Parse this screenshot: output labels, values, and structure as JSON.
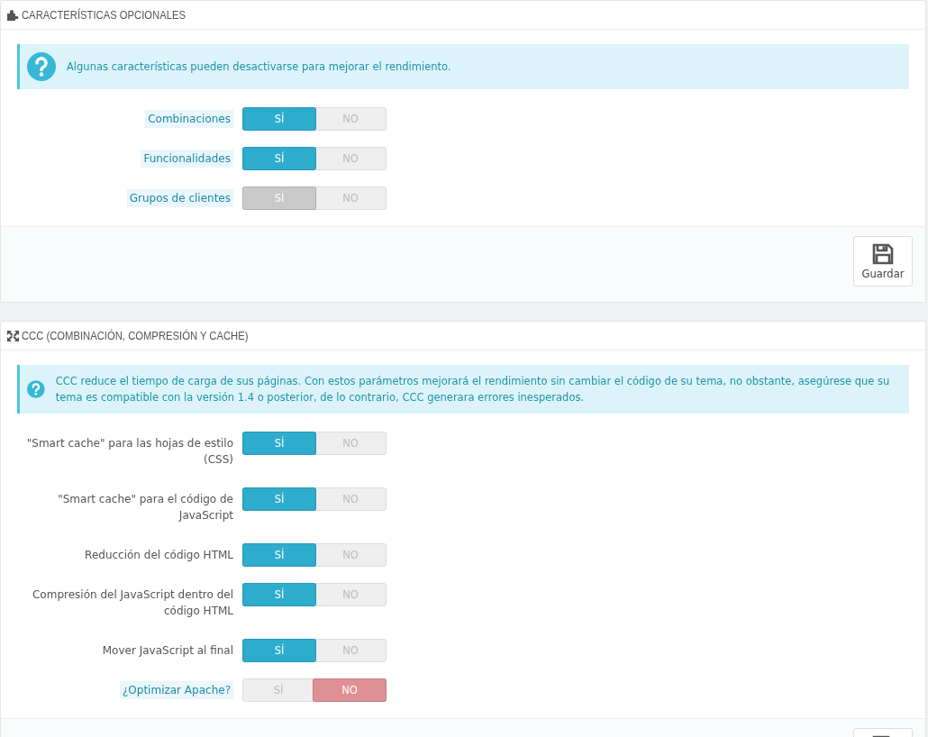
{
  "panels": [
    {
      "title": "CARACTERÍSTICAS OPCIONALES",
      "alert": "Algunas características pueden desactivarse para mejorar el rendimiento.",
      "fields": [
        {
          "label": "Combinaciones",
          "hint": true,
          "yes_label": "SÍ",
          "no_label": "NO",
          "on": true,
          "disabled": false
        },
        {
          "label": "Funcionalidades",
          "hint": true,
          "yes_label": "SÍ",
          "no_label": "NO",
          "on": true,
          "disabled": false
        },
        {
          "label": "Grupos de clientes",
          "hint": true,
          "yes_label": "SÍ",
          "no_label": "NO",
          "on": true,
          "disabled": true
        }
      ],
      "save": {
        "label": "Guardar"
      }
    },
    {
      "title": "CCC (COMBINACIÓN, COMPRESIÓN Y CACHE)",
      "alert": "CCC reduce el tiempo de carga de sus páginas. Con estos parámetros mejorará el rendimiento sin cambiar el código de su tema, no obstante, asegúrese que su tema es compatible con la versión 1.4 o posterior, de lo contrario, CCC generara errores inesperados.",
      "fields": [
        {
          "label": "\"Smart cache\" para las hojas de estilo (CSS)",
          "hint": false,
          "yes_label": "SÍ",
          "no_label": "NO",
          "on": true,
          "disabled": false
        },
        {
          "label": "\"Smart cache\" para el código de JavaScript",
          "hint": false,
          "yes_label": "SÍ",
          "no_label": "NO",
          "on": true,
          "disabled": false
        },
        {
          "label": "Reducción del código HTML",
          "hint": false,
          "yes_label": "SÍ",
          "no_label": "NO",
          "on": true,
          "disabled": false
        },
        {
          "label": "Compresión del JavaScript dentro del código HTML",
          "hint": false,
          "yes_label": "SÍ",
          "no_label": "NO",
          "on": true,
          "disabled": false
        },
        {
          "label": "Mover JavaScript al final",
          "hint": false,
          "yes_label": "SÍ",
          "no_label": "NO",
          "on": true,
          "disabled": false
        },
        {
          "label": "¿Optimizar Apache?",
          "hint": true,
          "yes_label": "SÍ",
          "no_label": "NO",
          "on": false,
          "disabled": false
        }
      ]
    }
  ]
}
